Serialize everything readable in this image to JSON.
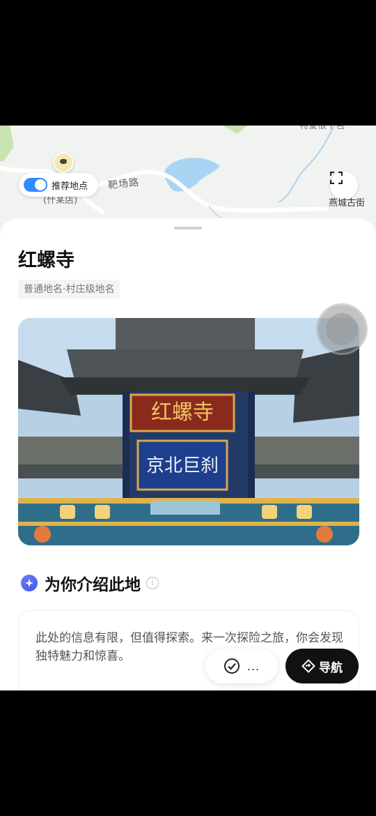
{
  "map": {
    "top_label": "特爱很十包",
    "road_label": "靶场路",
    "shop_label": "(什某店)",
    "recommend_toggle_label": "推荐地点",
    "recommend_toggle_on": true,
    "poi_label": "燕城古街"
  },
  "place": {
    "title": "红螺寺",
    "tag": "普通地名·村庄级地名",
    "photo_sign_top": "红螺寺",
    "photo_sign_bottom": "京北巨刹"
  },
  "intro": {
    "title": "为你介绍此地",
    "text": "此处的信息有限，但值得探索。来一次探险之旅，你会发现独特魅力和惊喜。"
  },
  "actions": {
    "more_label": "...",
    "navigate_label": "导航"
  },
  "colors": {
    "accent_blue": "#2f8cff",
    "nav_button": "#111111",
    "water": "#a9d4f3"
  }
}
